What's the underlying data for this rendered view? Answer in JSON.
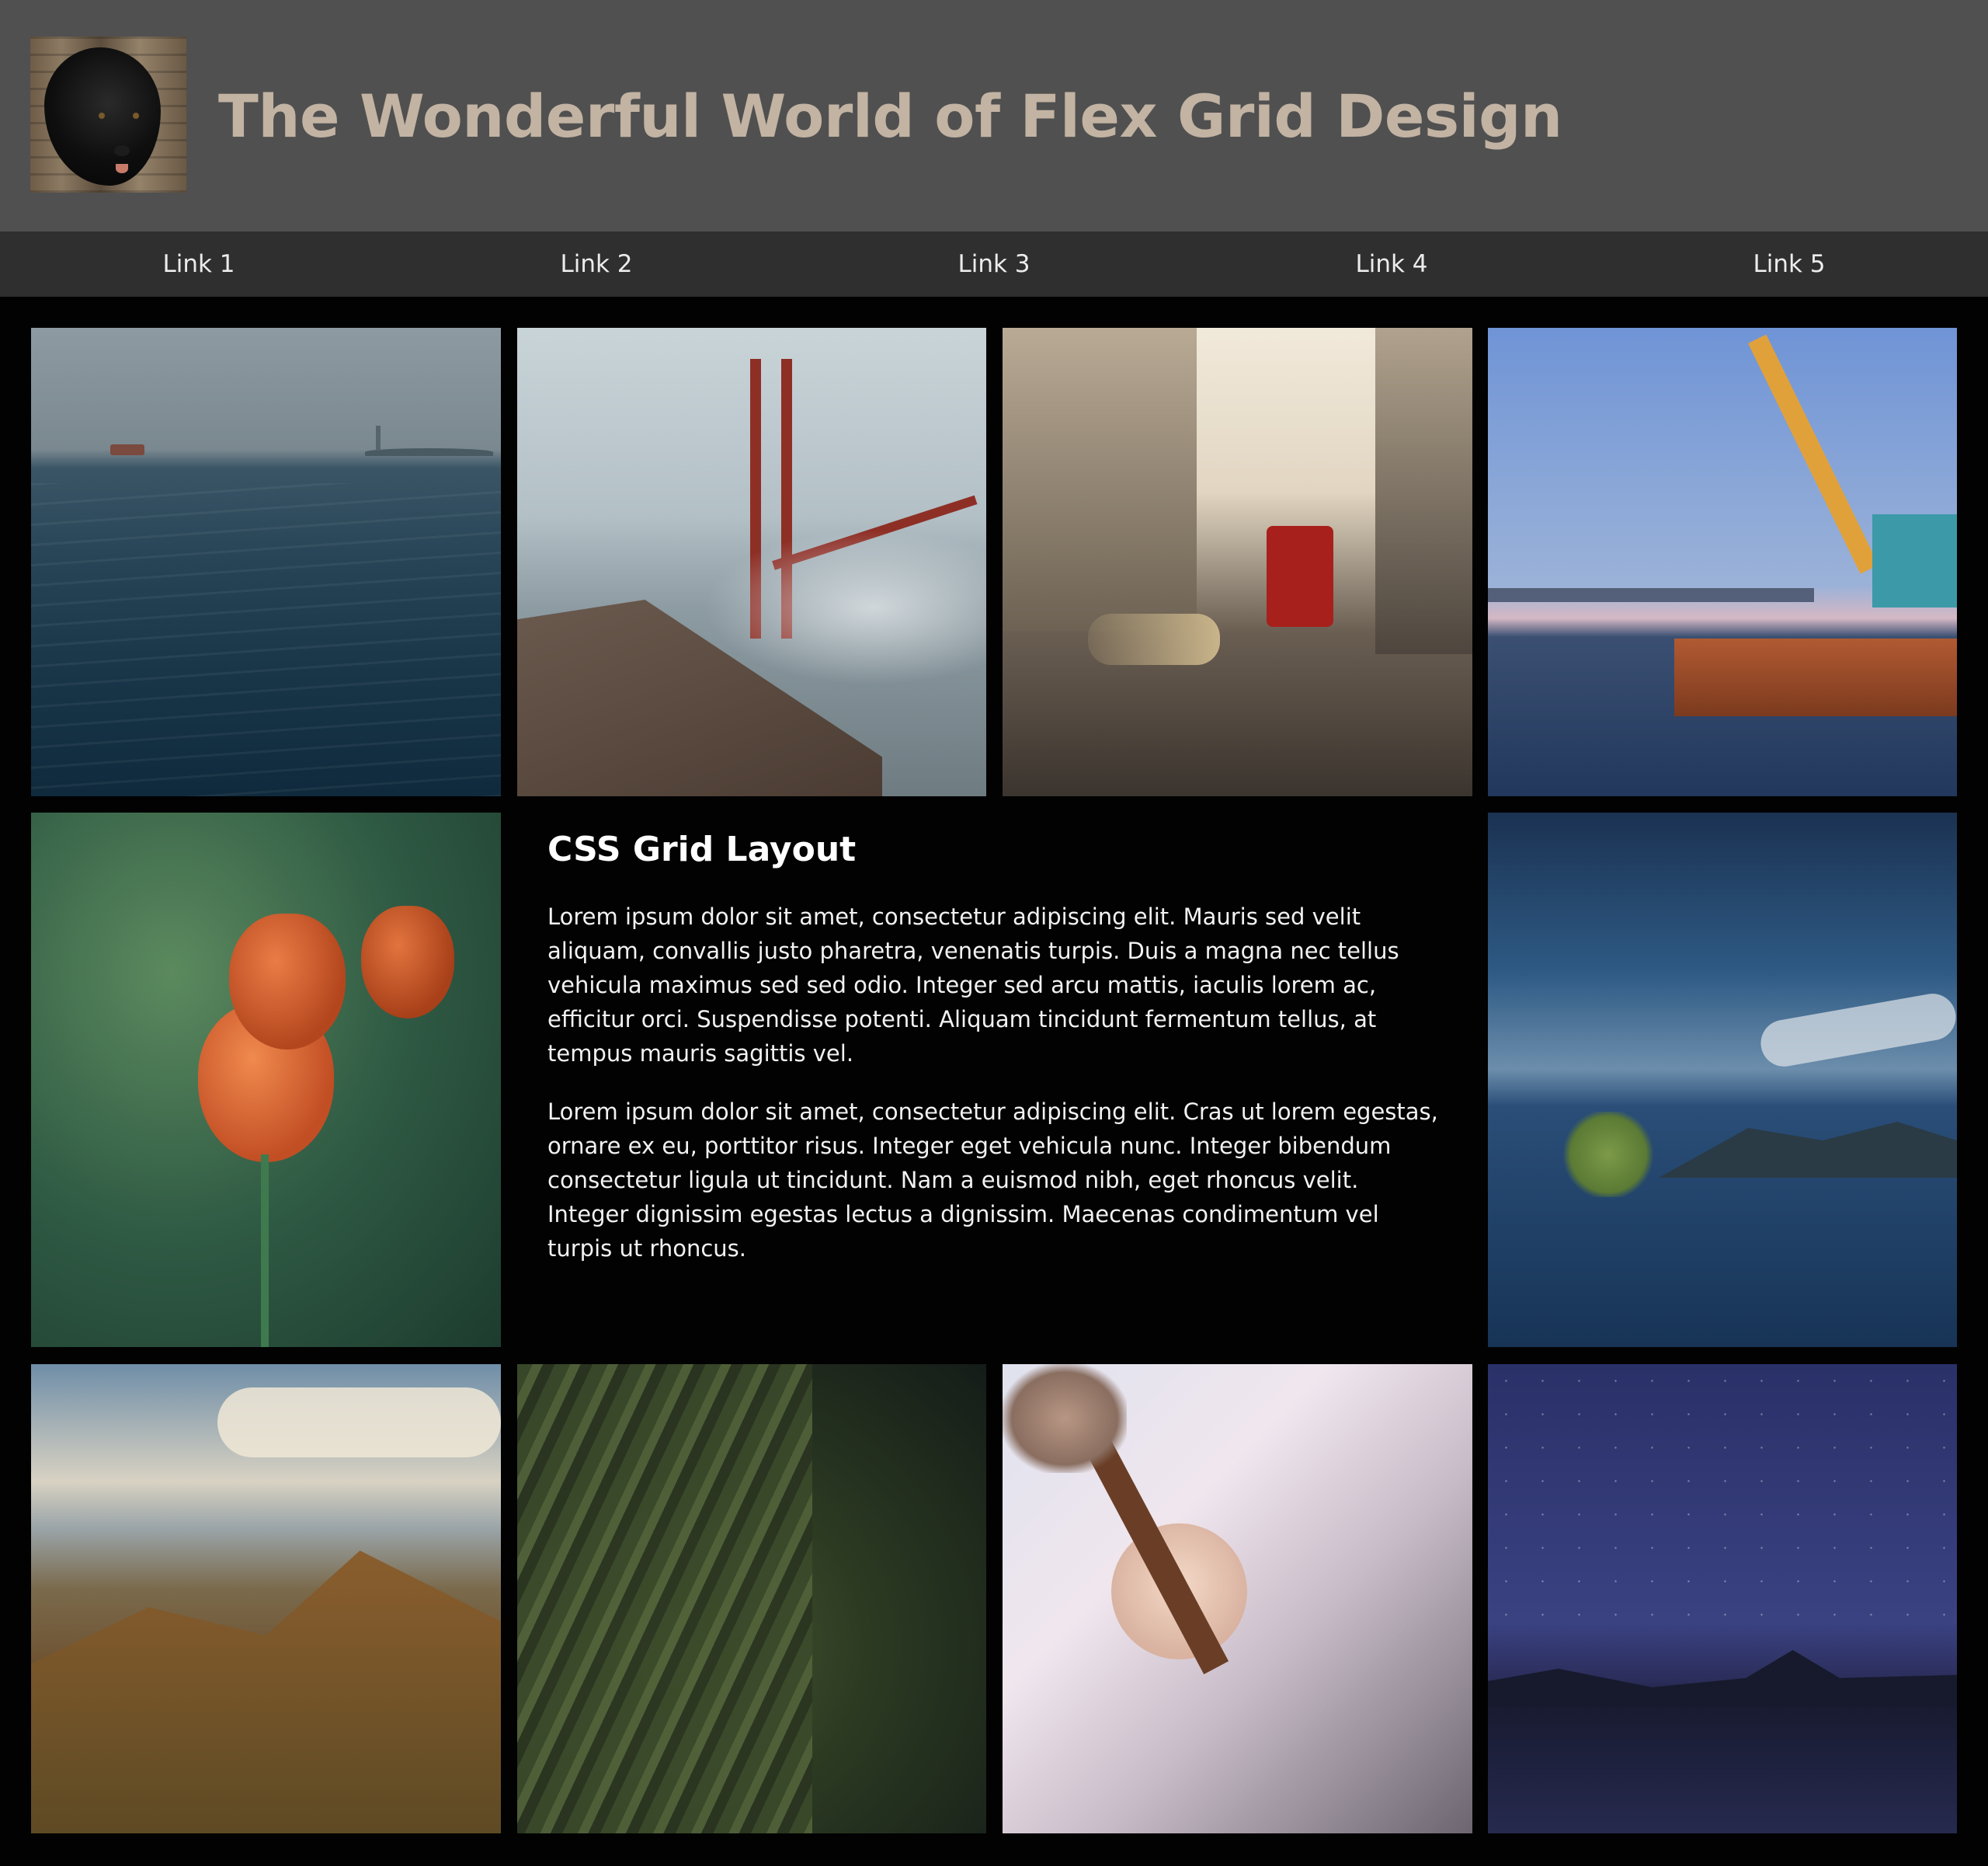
{
  "header": {
    "title": "The Wonderful World of Flex Grid Design",
    "logo_icon": "black-dog-photo-icon"
  },
  "nav": {
    "links": [
      "Link 1",
      "Link 2",
      "Link 3",
      "Link 4",
      "Link 5"
    ]
  },
  "article": {
    "heading": "CSS Grid Layout",
    "paragraphs": [
      "Lorem ipsum dolor sit amet, consectetur adipiscing elit. Mauris sed velit aliquam, convallis justo pharetra, venenatis turpis. Duis a magna nec tellus vehicula maximus sed sed odio. Integer sed arcu mattis, iaculis lorem ac, efficitur orci. Suspendisse potenti. Aliquam tincidunt fermentum tellus, at tempus mauris sagittis vel.",
      "Lorem ipsum dolor sit amet, consectetur adipiscing elit. Cras ut lorem egestas, ornare ex eu, porttitor risus. Integer eget vehicula nunc. Integer bibendum consectetur ligula ut tincidunt. Nam a euismod nibh, eget rhoncus velit. Integer dignissim egestas lectus a dignissim. Maecenas condimentum vel turpis ut rhoncus."
    ]
  },
  "gallery": {
    "images": [
      {
        "subject": "ocean-with-ferry-and-statue-of-liberty"
      },
      {
        "subject": "golden-gate-bridge-in-fog"
      },
      {
        "subject": "london-street-with-red-bus"
      },
      {
        "subject": "harbor-crane-barge"
      },
      {
        "subject": "orange-tulips"
      },
      {
        "subject": "lone-tree-in-lake"
      },
      {
        "subject": "mountain-landscape-with-clouds"
      },
      {
        "subject": "moss-covered-tree-bark"
      },
      {
        "subject": "baby-with-phone"
      },
      {
        "subject": "night-sky-over-mountain-lake"
      }
    ]
  },
  "colors": {
    "page_background": "#020202",
    "header_background": "#505050",
    "nav_background": "#2f2f2f",
    "title_text": "#c2b3a3",
    "nav_text": "#ececec"
  }
}
